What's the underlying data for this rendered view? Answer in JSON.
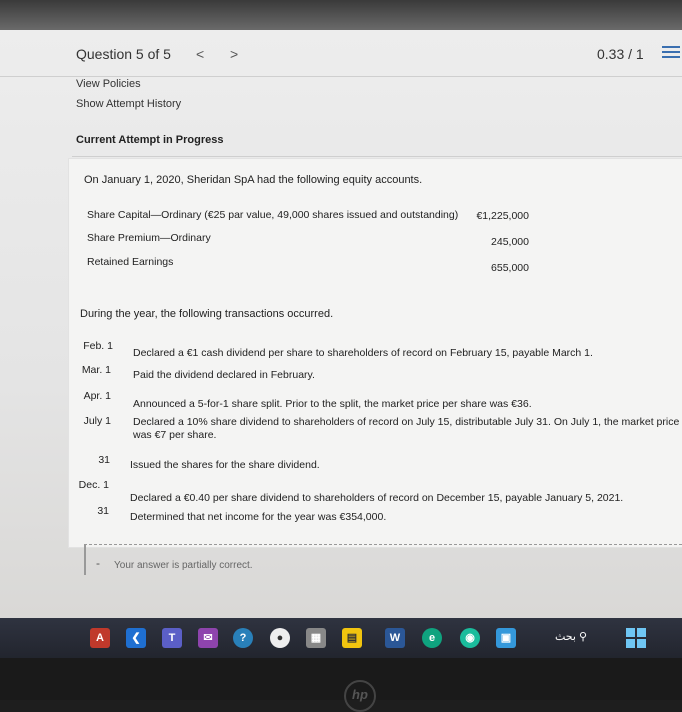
{
  "question": {
    "title": "Question 5 of 5",
    "prev": "<",
    "next": ">",
    "score": "0.33 / 1"
  },
  "links": {
    "view_policies": "View Policies",
    "show_attempt_history": "Show Attempt History"
  },
  "section_label": "Current Attempt in Progress",
  "problem": {
    "intro": "On January 1, 2020, Sheridan SpA had the following equity accounts.",
    "accounts": [
      {
        "label": "Share Capital—Ordinary (€25 par value, 49,000 shares issued and outstanding)",
        "value": "€1,225,000"
      },
      {
        "label": "Share Premium—Ordinary",
        "value": "245,000"
      },
      {
        "label": "Retained Earnings",
        "value": "655,000"
      }
    ],
    "transactions_intro": "During the year, the following transactions occurred.",
    "transactions": [
      {
        "date": "Feb. 1",
        "desc": "Declared a €1 cash dividend per share to shareholders of record on February 15, payable March 1."
      },
      {
        "date": "Mar. 1",
        "desc": "Paid the dividend declared in February."
      },
      {
        "date": "Apr. 1",
        "desc": "Announced a 5-for-1 share split. Prior to the split, the market price per share was €36."
      },
      {
        "date": "July 1",
        "desc": "Declared a 10% share dividend to shareholders of record on July 15, distributable July 31. On July 1, the market price was €7 per share."
      },
      {
        "date": "31",
        "desc": "Issued the shares for the share dividend."
      },
      {
        "date": "Dec. 1",
        "desc": "Declared a €0.40 per share dividend to shareholders of record on December 15, payable January 5, 2021."
      },
      {
        "date": "31",
        "desc": "Determined that net income for the year was €354,000."
      }
    ]
  },
  "answer": {
    "dash": "-",
    "status": "Your answer is partially correct."
  },
  "taskbar": {
    "search_label": "بحث",
    "icons": [
      "app-a-icon",
      "vscode-icon",
      "teams-icon",
      "mail-icon",
      "help-icon",
      "chrome-icon",
      "store-icon",
      "files-icon",
      "word-icon",
      "edge-icon",
      "maps-icon",
      "photos-icon"
    ]
  },
  "logo": "hp"
}
